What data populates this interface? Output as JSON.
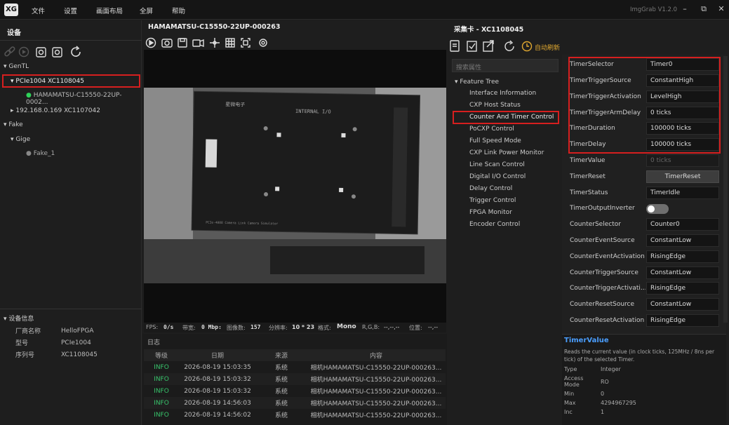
{
  "app": {
    "logo": "XG",
    "title": "ImgGrab V1.2.0",
    "menus": [
      "文件",
      "设置",
      "画面布局",
      "全屏",
      "帮助"
    ]
  },
  "device_panel": {
    "header": "设备",
    "tree": [
      {
        "label": "GenTL"
      },
      {
        "label": "PCIe1004 XC1108045"
      },
      {
        "label": "HAMAMATSU-C15550-22UP-0002..."
      },
      {
        "label": "192.168.0.169 XC1107042"
      },
      {
        "label": "Fake"
      },
      {
        "label": "Gige"
      },
      {
        "label": "Fake_1"
      }
    ],
    "info_header": "设备信息",
    "info": [
      {
        "k": "厂商名称",
        "v": "HelloFPGA"
      },
      {
        "k": "型号",
        "v": "PCIe1004"
      },
      {
        "k": "序列号",
        "v": "XC1108045"
      }
    ]
  },
  "camera": {
    "title": "HAMAMATSU-C15550-22UP-000263",
    "image": {
      "board_title": "INTERNAL I/O",
      "board_brand": "星微电子",
      "board_caption": "PCIe-4008 Camera Link Camera Simulator"
    },
    "status": {
      "fps_label": "FPS:",
      "fps": "0/s",
      "bw_label": "带宽:",
      "bw": "0 Mbp:",
      "frames_label": "图像数:",
      "frames": "157",
      "res_label": "分辨率:",
      "res": "10 * 23",
      "fmt_label": "格式:",
      "fmt": "Mono",
      "rgb_label": "R,G,B:",
      "rgb": "--,--,--",
      "pos_label": "位置:",
      "pos": "--,--"
    }
  },
  "log": {
    "tab": "日志",
    "cols": [
      "等级",
      "日期",
      "来源",
      "内容"
    ],
    "rows": [
      {
        "level": "INFO",
        "date": "2026-08-19 15:03:35",
        "src": "系统",
        "msg": "相机HAMAMATSU-C15550-22UP-000263..."
      },
      {
        "level": "INFO",
        "date": "2026-08-19 15:03:32",
        "src": "系统",
        "msg": "相机HAMAMATSU-C15550-22UP-000263..."
      },
      {
        "level": "INFO",
        "date": "2026-08-19 15:03:32",
        "src": "系统",
        "msg": "相机HAMAMATSU-C15550-22UP-000263..."
      },
      {
        "level": "INFO",
        "date": "2026-08-19 14:56:03",
        "src": "系统",
        "msg": "相机HAMAMATSU-C15550-22UP-000263..."
      },
      {
        "level": "INFO",
        "date": "2026-08-19 14:56:02",
        "src": "系统",
        "msg": "相机HAMAMATSU-C15550-22UP-000263..."
      }
    ]
  },
  "grabber": {
    "header": "采集卡 - XC1108045",
    "auto_refresh": "自动刷新",
    "search_placeholder": "搜索属性",
    "tree_root": "Feature Tree",
    "features": [
      "Interface Information",
      "CXP Host Status",
      "Counter And Timer Control",
      "PoCXP Control",
      "Full Speed Mode",
      "CXP Link Power Monitor",
      "Line Scan Control",
      "Digital I/O Control",
      "Delay Control",
      "Trigger Control",
      "FPGA Monitor",
      "Encoder Control"
    ]
  },
  "props": [
    {
      "k": "TimerSelector",
      "v": "Timer0"
    },
    {
      "k": "TimerTriggerSource",
      "v": "ConstantHigh"
    },
    {
      "k": "TimerTriggerActivation",
      "v": "LevelHigh"
    },
    {
      "k": "TimerTriggerArmDelay",
      "v": "0 ticks"
    },
    {
      "k": "TimerDuration",
      "v": "100000 ticks"
    },
    {
      "k": "TimerDelay",
      "v": "100000 ticks"
    },
    {
      "k": "TimerValue",
      "v": "0 ticks"
    },
    {
      "k": "TimerReset",
      "v": "TimerReset"
    },
    {
      "k": "TimerStatus",
      "v": "TimerIdle"
    },
    {
      "k": "TimerOutputInverter",
      "v": ""
    },
    {
      "k": "CounterSelector",
      "v": "Counter0"
    },
    {
      "k": "CounterEventSource",
      "v": "ConstantLow"
    },
    {
      "k": "CounterEventActivation",
      "v": "RisingEdge"
    },
    {
      "k": "CounterTriggerSource",
      "v": "ConstantLow"
    },
    {
      "k": "CounterTriggerActivati...",
      "v": "RisingEdge"
    },
    {
      "k": "CounterResetSource",
      "v": "ConstantLow"
    },
    {
      "k": "CounterResetActivation",
      "v": "RisingEdge"
    }
  ],
  "desc": {
    "title": "TimerValue",
    "text": "Reads the current value (in clock ticks, 125MHz / 8ns per tick) of the selected Timer.",
    "rows": [
      {
        "k": "Type",
        "v": "Integer"
      },
      {
        "k": "Access Mode",
        "v": "RO"
      },
      {
        "k": "Min",
        "v": "0"
      },
      {
        "k": "Max",
        "v": "4294967295"
      },
      {
        "k": "Inc",
        "v": "1"
      }
    ]
  }
}
